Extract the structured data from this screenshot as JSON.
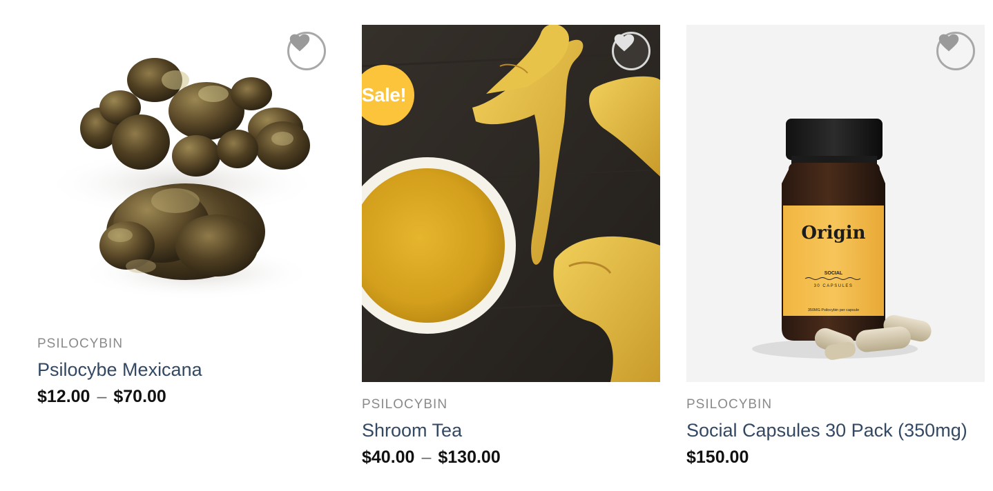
{
  "products": [
    {
      "category": "PSILOCYBIN",
      "title": "Psilocybe Mexicana",
      "price_low": "$12.00",
      "price_sep": "–",
      "price_high": "$70.00",
      "image": "mushroom-truffles-image",
      "wishlist_icon": "heart-icon",
      "on_sale": false
    },
    {
      "category": "PSILOCYBIN",
      "title": "Shroom Tea",
      "price_low": "$40.00",
      "price_sep": "–",
      "price_high": "$130.00",
      "image": "tea-and-mushrooms-image",
      "wishlist_icon": "heart-icon",
      "on_sale": true,
      "sale_badge": "Sale!"
    },
    {
      "category": "PSILOCYBIN",
      "title": "Social Capsules 30 Pack (350mg)",
      "price": "$150.00",
      "image": "capsule-bottle-image",
      "wishlist_icon": "heart-icon",
      "on_sale": false,
      "bottle_label": {
        "brand": "Origin",
        "line": "SOCIAL",
        "count": "30 CAPSULES",
        "dose": "350MG Psilocybin per capsule"
      }
    }
  ],
  "colors": {
    "title": "#334862",
    "category": "#8a8a8a",
    "price": "#111111",
    "sale_badge": "#fcc43a"
  }
}
